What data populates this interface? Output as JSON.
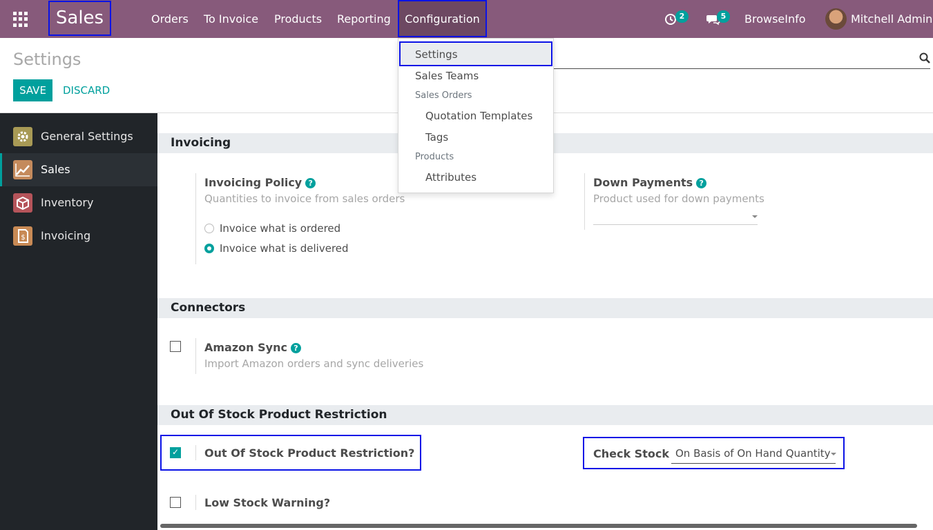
{
  "navbar": {
    "brand": "Sales",
    "menu": [
      "Orders",
      "To Invoice",
      "Products",
      "Reporting",
      "Configuration"
    ],
    "activity_count": "2",
    "message_count": "5",
    "company": "BrowseInfo",
    "user": "Mitchell Admin"
  },
  "dropdown": {
    "items": [
      {
        "label": "Settings",
        "type": "item"
      },
      {
        "label": "Sales Teams",
        "type": "item"
      },
      {
        "label": "Sales Orders",
        "type": "header"
      },
      {
        "label": "Quotation Templates",
        "type": "subitem"
      },
      {
        "label": "Tags",
        "type": "subitem"
      },
      {
        "label": "Products",
        "type": "header"
      },
      {
        "label": "Attributes",
        "type": "subitem"
      }
    ]
  },
  "control_panel": {
    "title": "Settings",
    "save_label": "SAVE",
    "discard_label": "DISCARD"
  },
  "sidebar": {
    "items": [
      {
        "label": "General Settings",
        "icon": "gear-icon"
      },
      {
        "label": "Sales",
        "icon": "sales-chart-icon"
      },
      {
        "label": "Inventory",
        "icon": "inventory-box-icon"
      },
      {
        "label": "Invoicing",
        "icon": "invoice-icon"
      }
    ],
    "active_index": 1
  },
  "sections": {
    "invoicing": {
      "title": "Invoicing",
      "policy_label": "Invoicing Policy",
      "policy_desc": "Quantities to invoice from sales orders",
      "options": [
        "Invoice what is ordered",
        "Invoice what is delivered"
      ],
      "selected_option": 1,
      "down_payments_label": "Down Payments",
      "down_payments_desc": "Product used for down payments",
      "down_payments_value": ""
    },
    "connectors": {
      "title": "Connectors",
      "amazon_label": "Amazon Sync",
      "amazon_desc": "Import Amazon orders and sync deliveries",
      "amazon_checked": false
    },
    "stock": {
      "title": "Out Of Stock Product Restriction",
      "restriction_label": "Out Of Stock Product Restriction?",
      "restriction_checked": true,
      "check_stock_label": "Check Stock",
      "check_stock_value": "On Basis of On Hand Quantity",
      "low_stock_label": "Low Stock Warning?",
      "low_stock_checked": false
    }
  },
  "colors": {
    "navbar": "#875a7b",
    "accent": "#00a09d",
    "highlight_border": "#0a12e6",
    "sidebar": "#212529"
  }
}
